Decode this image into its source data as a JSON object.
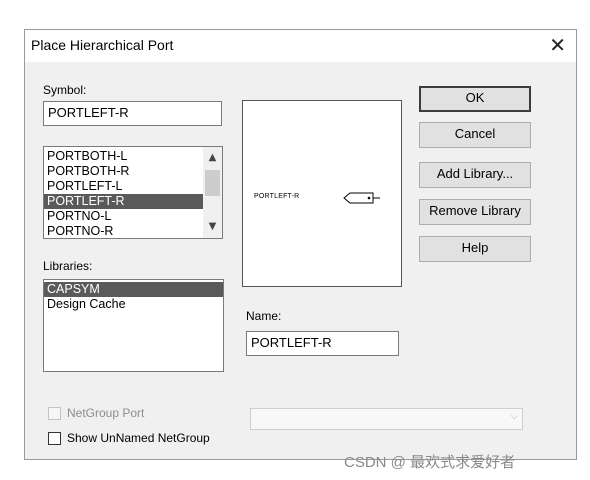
{
  "window": {
    "title": "Place Hierarchical Port",
    "close_glyph": "✕"
  },
  "symbol": {
    "label": "Symbol:",
    "value": "PORTLEFT-R",
    "list": [
      "PORTBOTH-L",
      "PORTBOTH-R",
      "PORTLEFT-L",
      "PORTLEFT-R",
      "PORTNO-L",
      "PORTNO-R"
    ],
    "selected": "PORTLEFT-R"
  },
  "libraries": {
    "label": "Libraries:",
    "items": [
      "CAPSYM",
      "Design Cache"
    ],
    "selected": "CAPSYM"
  },
  "preview": {
    "port_label": "PORTLEFT-R"
  },
  "name": {
    "label": "Name:",
    "value": "PORTLEFT-R"
  },
  "buttons": {
    "ok": "OK",
    "cancel": "Cancel",
    "add_library": "Add Library...",
    "remove_library": "Remove Library",
    "help": "Help"
  },
  "netgroup": {
    "port_label": "NetGroup Port",
    "show_unnamed_label": "Show UnNamed NetGroup"
  },
  "watermark": "CSDN @ 最欢式求爱好者",
  "icons": {
    "scroll_up": "▲",
    "scroll_down": "▼",
    "combo_down": "⌵"
  }
}
